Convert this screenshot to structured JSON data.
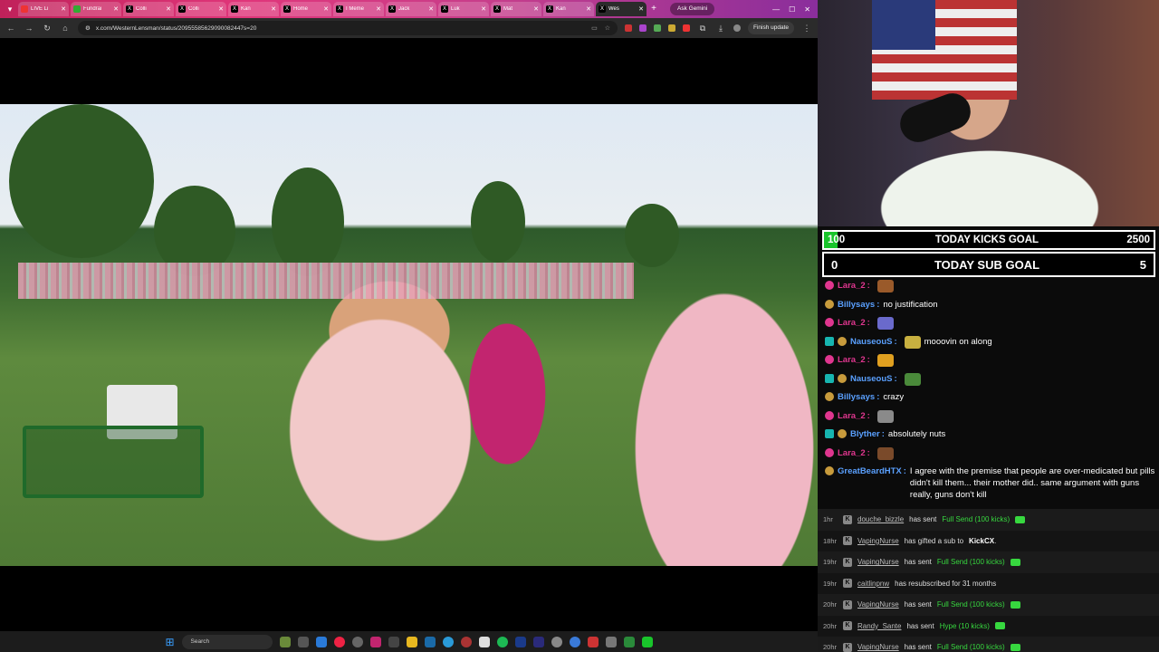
{
  "browser": {
    "tabs": [
      {
        "label": "LIVE Li",
        "fav": "red",
        "active": false
      },
      {
        "label": "Fundrai",
        "fav": "green",
        "active": false
      },
      {
        "label": "Colli",
        "fav": "x",
        "active": false
      },
      {
        "label": "Colli",
        "fav": "x",
        "active": false
      },
      {
        "label": "Kan",
        "fav": "x",
        "active": false
      },
      {
        "label": "Home",
        "fav": "x",
        "active": false
      },
      {
        "label": "I Meme",
        "fav": "x",
        "active": false
      },
      {
        "label": "Jack",
        "fav": "x",
        "active": false
      },
      {
        "label": "Luk",
        "fav": "x",
        "active": false
      },
      {
        "label": "Mat",
        "fav": "x",
        "active": false
      },
      {
        "label": "Kan",
        "fav": "x",
        "active": false
      },
      {
        "label": "Wes",
        "fav": "x",
        "active": true
      }
    ],
    "new_tab": "+",
    "ask_gemini": "Ask Gemini",
    "url": "x.com/WesternLensman/status/20955585629090082447s=20",
    "finish_update": "Finish update"
  },
  "taskbar": {
    "search_placeholder": "Search"
  },
  "goals": {
    "kicks": {
      "current": "100",
      "label": "TODAY KICKS GOAL",
      "target": "2500",
      "progress": 0.04
    },
    "subs": {
      "current": "0",
      "label": "TODAY SUB GOAL",
      "target": "5",
      "progress": 0.0
    }
  },
  "chat": [
    {
      "badges": [
        "pink"
      ],
      "user": "Lara_2",
      "user_color": "#e0368f",
      "text": "",
      "emote": "#9a5a2a"
    },
    {
      "badges": [
        "gold"
      ],
      "user": "Billysays",
      "user_color": "#5aa0ff",
      "text": "no justification",
      "emote": ""
    },
    {
      "badges": [
        "pink"
      ],
      "user": "Lara_2",
      "user_color": "#e0368f",
      "text": "",
      "emote": "#6a6acc"
    },
    {
      "badges": [
        "teal",
        "gold"
      ],
      "user": "NauseouS",
      "user_color": "#5aa0ff",
      "text": "mooovin on along",
      "emote": "#c8b040"
    },
    {
      "badges": [
        "pink"
      ],
      "user": "Lara_2",
      "user_color": "#e0368f",
      "text": "",
      "emote": "#e0a020"
    },
    {
      "badges": [
        "teal",
        "gold"
      ],
      "user": "NauseouS",
      "user_color": "#5aa0ff",
      "text": "",
      "emote": "#4a8a3a"
    },
    {
      "badges": [
        "gold"
      ],
      "user": "Billysays",
      "user_color": "#5aa0ff",
      "text": "crazy",
      "emote": ""
    },
    {
      "badges": [
        "pink"
      ],
      "user": "Lara_2",
      "user_color": "#e0368f",
      "text": "",
      "emote": "#8a8a8a"
    },
    {
      "badges": [
        "teal",
        "gold"
      ],
      "user": "Blyther",
      "user_color": "#5aa0ff",
      "text": "absolutely nuts",
      "emote": ""
    },
    {
      "badges": [
        "pink"
      ],
      "user": "Lara_2",
      "user_color": "#e0368f",
      "text": "",
      "emote": "#7a4a2a"
    },
    {
      "badges": [
        "gold"
      ],
      "user": "GreatBeardHTX",
      "user_color": "#5aa0ff",
      "text": "I agree with the premise that people are over-medicated but pills didn't kill them... their mother did.. same argument with guns really, guns don't kill",
      "emote": "",
      "long": true
    }
  ],
  "activity": [
    {
      "age": "1hr",
      "who": "douche_bizzle",
      "pre": "has sent",
      "highlight": "Full Send (100 kicks)",
      "channel": "",
      "post": "",
      "gift": true
    },
    {
      "age": "18hr",
      "who": "VapingNurse",
      "pre": "has gifted a sub to",
      "highlight": "",
      "channel": "KickCX",
      "post": ".",
      "gift": false
    },
    {
      "age": "19hr",
      "who": "VapingNurse",
      "pre": "has sent",
      "highlight": "Full Send (100 kicks)",
      "channel": "",
      "post": "",
      "gift": true
    },
    {
      "age": "19hr",
      "who": "caitlinpnw",
      "pre": "has resubscribed for 31 months",
      "highlight": "",
      "channel": "",
      "post": "",
      "gift": false
    },
    {
      "age": "20hr",
      "who": "VapingNurse",
      "pre": "has sent",
      "highlight": "Full Send (100 kicks)",
      "channel": "",
      "post": "",
      "gift": true
    },
    {
      "age": "20hr",
      "who": "Randy_Sante",
      "pre": "has sent",
      "highlight": "Hype (10 kicks)",
      "channel": "",
      "post": "",
      "gift": true
    },
    {
      "age": "20hr",
      "who": "VapingNurse",
      "pre": "has sent",
      "highlight": "Full Send (100 kicks)",
      "channel": "",
      "post": "",
      "gift": true
    }
  ]
}
